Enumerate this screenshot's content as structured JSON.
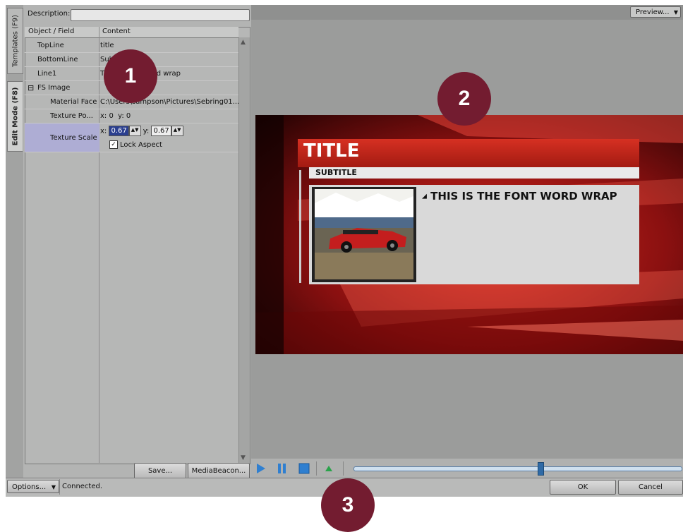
{
  "tabs": {
    "templates": "Templates (F9)",
    "edit_mode": "Edit Mode (F8)"
  },
  "description": {
    "label": "Description:",
    "value": ""
  },
  "grid": {
    "col_field": "Object / Field",
    "col_content": "Content",
    "rows": [
      {
        "field": "TopLine",
        "content": "title"
      },
      {
        "field": "BottomLine",
        "content": "Sub"
      },
      {
        "field": "Line1",
        "content": "T                    ord wrap"
      },
      {
        "field": "FS Image",
        "content": "",
        "group": true,
        "expander": "⊟"
      },
      {
        "field": "Material Face",
        "content": "C:\\Users\\sampson\\Pictures\\Sebring01..."
      },
      {
        "field": "Texture Po...",
        "content": "x: 0  y: 0"
      },
      {
        "field": "Texture Scale",
        "x_label": "x:",
        "x_value": "0.67",
        "y_label": "y:",
        "y_value": "0.67",
        "lock_label": "Lock Aspect",
        "lock_checked": true
      }
    ]
  },
  "buttons": {
    "save": "Save...",
    "mediabeacon": "MediaBeacon...",
    "preview": "Preview...",
    "ok": "OK",
    "cancel": "Cancel",
    "options": "Options..."
  },
  "status": {
    "text": "Connected."
  },
  "graphic": {
    "title": "TITLE",
    "subtitle": "SUBTITLE",
    "body": "THIS IS THE FONT WORD WRAP"
  },
  "transport": {
    "position": 0.57
  },
  "markers": [
    "1",
    "2",
    "3"
  ],
  "colors": {
    "accent_red": "#c8201a",
    "marker": "#731c30",
    "play_blue": "#2f7fd0",
    "selection": "#2b3f8f"
  },
  "icons": {
    "play": "play-icon",
    "pause": "pause-icon",
    "stop": "stop-icon",
    "eject": "eject-icon",
    "dropdown": "chevron-down-icon",
    "scroll_up": "scroll-up-icon",
    "scroll_down": "scroll-down-icon"
  }
}
